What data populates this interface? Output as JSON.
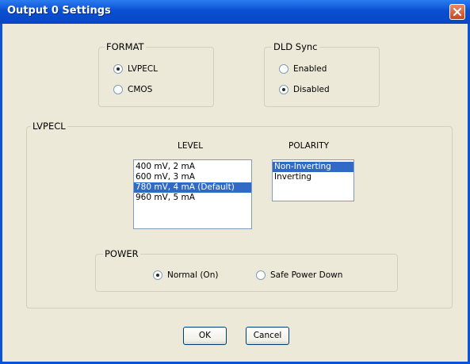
{
  "window": {
    "title": "Output 0 Settings"
  },
  "format": {
    "legend": "FORMAT",
    "options": [
      {
        "label": "LVPECL",
        "checked": true
      },
      {
        "label": "CMOS",
        "checked": false
      }
    ]
  },
  "dld_sync": {
    "legend": "DLD Sync",
    "options": [
      {
        "label": "Enabled",
        "checked": false
      },
      {
        "label": "Disabled",
        "checked": true
      }
    ]
  },
  "lvpecl": {
    "legend": "LVPECL",
    "level": {
      "label": "LEVEL",
      "items": [
        "400 mV, 2 mA",
        "600 mV, 3 mA",
        "780 mV, 4 mA (Default)",
        "960 mV, 5 mA"
      ],
      "selected": "780 mV, 4 mA (Default)"
    },
    "polarity": {
      "label": "POLARITY",
      "items": [
        "Non-Inverting",
        "Inverting"
      ],
      "selected": "Non-Inverting"
    },
    "power": {
      "legend": "POWER",
      "options": [
        {
          "label": "Normal (On)",
          "checked": true
        },
        {
          "label": "Safe Power Down",
          "checked": false
        }
      ]
    }
  },
  "buttons": {
    "ok_label": "OK",
    "cancel_label": "Cancel"
  },
  "icons": {
    "close": "close-icon"
  }
}
